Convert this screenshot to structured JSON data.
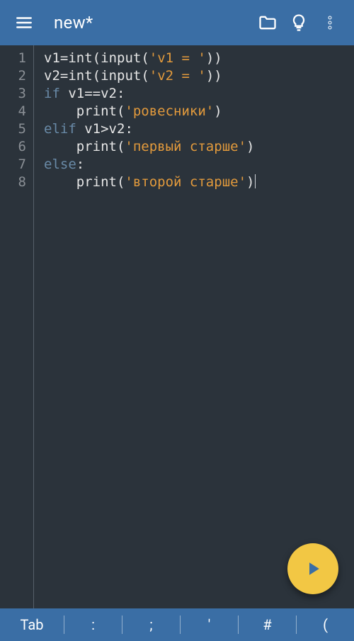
{
  "appbar": {
    "title": "new*",
    "menu_icon": "menu-icon",
    "folder_icon": "folder-icon",
    "bulb_icon": "bulb-icon",
    "overflow_icon": "overflow-icon"
  },
  "editor": {
    "lines": [
      {
        "n": "1",
        "tokens": [
          {
            "c": "tok-id",
            "t": "v1"
          },
          {
            "c": "tok-op",
            "t": "="
          },
          {
            "c": "tok-fn",
            "t": "int"
          },
          {
            "c": "tok-paren",
            "t": "("
          },
          {
            "c": "tok-fn",
            "t": "input"
          },
          {
            "c": "tok-paren",
            "t": "("
          },
          {
            "c": "tok-str",
            "t": "'v1 = '"
          },
          {
            "c": "tok-paren",
            "t": "))"
          }
        ]
      },
      {
        "n": "2",
        "tokens": [
          {
            "c": "tok-id",
            "t": "v2"
          },
          {
            "c": "tok-op",
            "t": "="
          },
          {
            "c": "tok-fn",
            "t": "int"
          },
          {
            "c": "tok-paren",
            "t": "("
          },
          {
            "c": "tok-fn",
            "t": "input"
          },
          {
            "c": "tok-paren",
            "t": "("
          },
          {
            "c": "tok-str",
            "t": "'v2 = '"
          },
          {
            "c": "tok-paren",
            "t": "))"
          }
        ]
      },
      {
        "n": "3",
        "tokens": [
          {
            "c": "tok-kw",
            "t": "if"
          },
          {
            "c": "tok-id",
            "t": " v1"
          },
          {
            "c": "tok-op",
            "t": "=="
          },
          {
            "c": "tok-id",
            "t": "v2"
          },
          {
            "c": "tok-op",
            "t": ":"
          }
        ]
      },
      {
        "n": "4",
        "tokens": [
          {
            "c": "tok-id",
            "t": "    "
          },
          {
            "c": "tok-fn",
            "t": "print"
          },
          {
            "c": "tok-paren",
            "t": "("
          },
          {
            "c": "tok-str",
            "t": "'ровесники'"
          },
          {
            "c": "tok-paren",
            "t": ")"
          }
        ]
      },
      {
        "n": "5",
        "tokens": [
          {
            "c": "tok-kw",
            "t": "elif"
          },
          {
            "c": "tok-id",
            "t": " v1"
          },
          {
            "c": "tok-op",
            "t": ">"
          },
          {
            "c": "tok-id",
            "t": "v2"
          },
          {
            "c": "tok-op",
            "t": ":"
          }
        ]
      },
      {
        "n": "6",
        "tokens": [
          {
            "c": "tok-id",
            "t": "    "
          },
          {
            "c": "tok-fn",
            "t": "print"
          },
          {
            "c": "tok-paren",
            "t": "("
          },
          {
            "c": "tok-str",
            "t": "'первый старше'"
          },
          {
            "c": "tok-paren",
            "t": ")"
          }
        ]
      },
      {
        "n": "7",
        "tokens": [
          {
            "c": "tok-kw",
            "t": "else"
          },
          {
            "c": "tok-op",
            "t": ":"
          }
        ]
      },
      {
        "n": "8",
        "tokens": [
          {
            "c": "tok-id",
            "t": "    "
          },
          {
            "c": "tok-fn",
            "t": "print"
          },
          {
            "c": "tok-paren",
            "t": "("
          },
          {
            "c": "tok-str",
            "t": "'второй старше'"
          },
          {
            "c": "tok-paren",
            "t": ")"
          }
        ],
        "cursor_after": true
      }
    ]
  },
  "fab": {
    "label": "run"
  },
  "keybar": {
    "keys": [
      "Tab",
      ":",
      ";",
      "'",
      "#",
      "("
    ]
  },
  "colors": {
    "accent": "#3a6ea5",
    "editor_bg": "#2b333b",
    "fab": "#f2c744",
    "string": "#e29a3c",
    "keyword": "#698aa7"
  }
}
